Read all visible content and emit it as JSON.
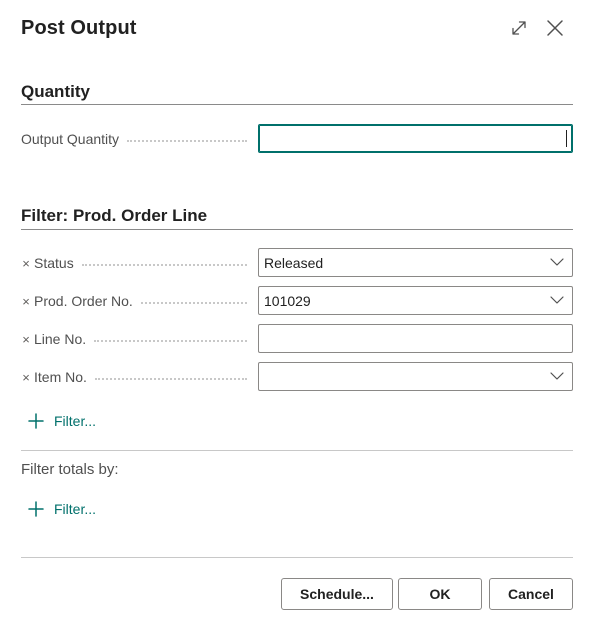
{
  "dialog": {
    "title": "Post Output"
  },
  "quantity_section": {
    "title": "Quantity",
    "fields": [
      {
        "label": "Output Quantity",
        "value": ""
      }
    ]
  },
  "filter_section": {
    "title": "Filter: Prod. Order Line",
    "fields": [
      {
        "label": "Status",
        "value": "Released",
        "has_dropdown": true
      },
      {
        "label": "Prod. Order No.",
        "value": "101029",
        "has_dropdown": true
      },
      {
        "label": "Line No.",
        "value": "",
        "has_dropdown": false
      },
      {
        "label": "Item No.",
        "value": "",
        "has_dropdown": true
      }
    ],
    "remove_symbol": "×",
    "add_filter_label": "Filter..."
  },
  "totals_section": {
    "title": "Filter totals by:",
    "add_filter_label": "Filter..."
  },
  "footer": {
    "schedule_label": "Schedule...",
    "ok_label": "OK",
    "cancel_label": "Cancel"
  },
  "icons": {
    "expand": "expand-diagonal-icon",
    "close": "close-icon",
    "remove_filter": "close-small-icon",
    "dropdown": "chevron-down-icon",
    "add": "plus-icon"
  },
  "colors": {
    "accent": "#00706b",
    "border": "#8a8886",
    "text": "#212121",
    "label": "#505050"
  }
}
